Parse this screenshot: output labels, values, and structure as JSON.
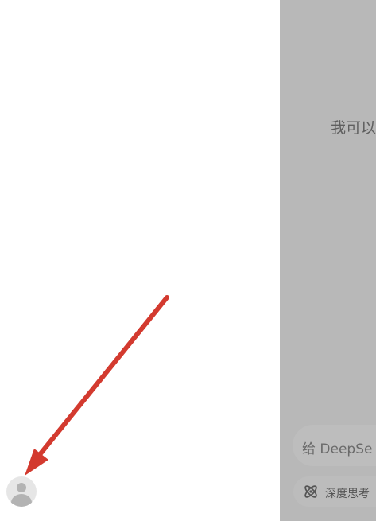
{
  "left_panel": {
    "avatar_icon": "user-avatar-icon"
  },
  "main": {
    "greeting": "我可以",
    "input": {
      "placeholder": "给 DeepSe"
    },
    "deep_think": {
      "label": "深度思考",
      "icon": "atom-icon"
    }
  },
  "annotation": {
    "arrow_color": "#d33a2f"
  },
  "colors": {
    "panel_bg": "#ffffff",
    "overlay_bg": "#b8b8b8",
    "divider": "#ededed"
  }
}
